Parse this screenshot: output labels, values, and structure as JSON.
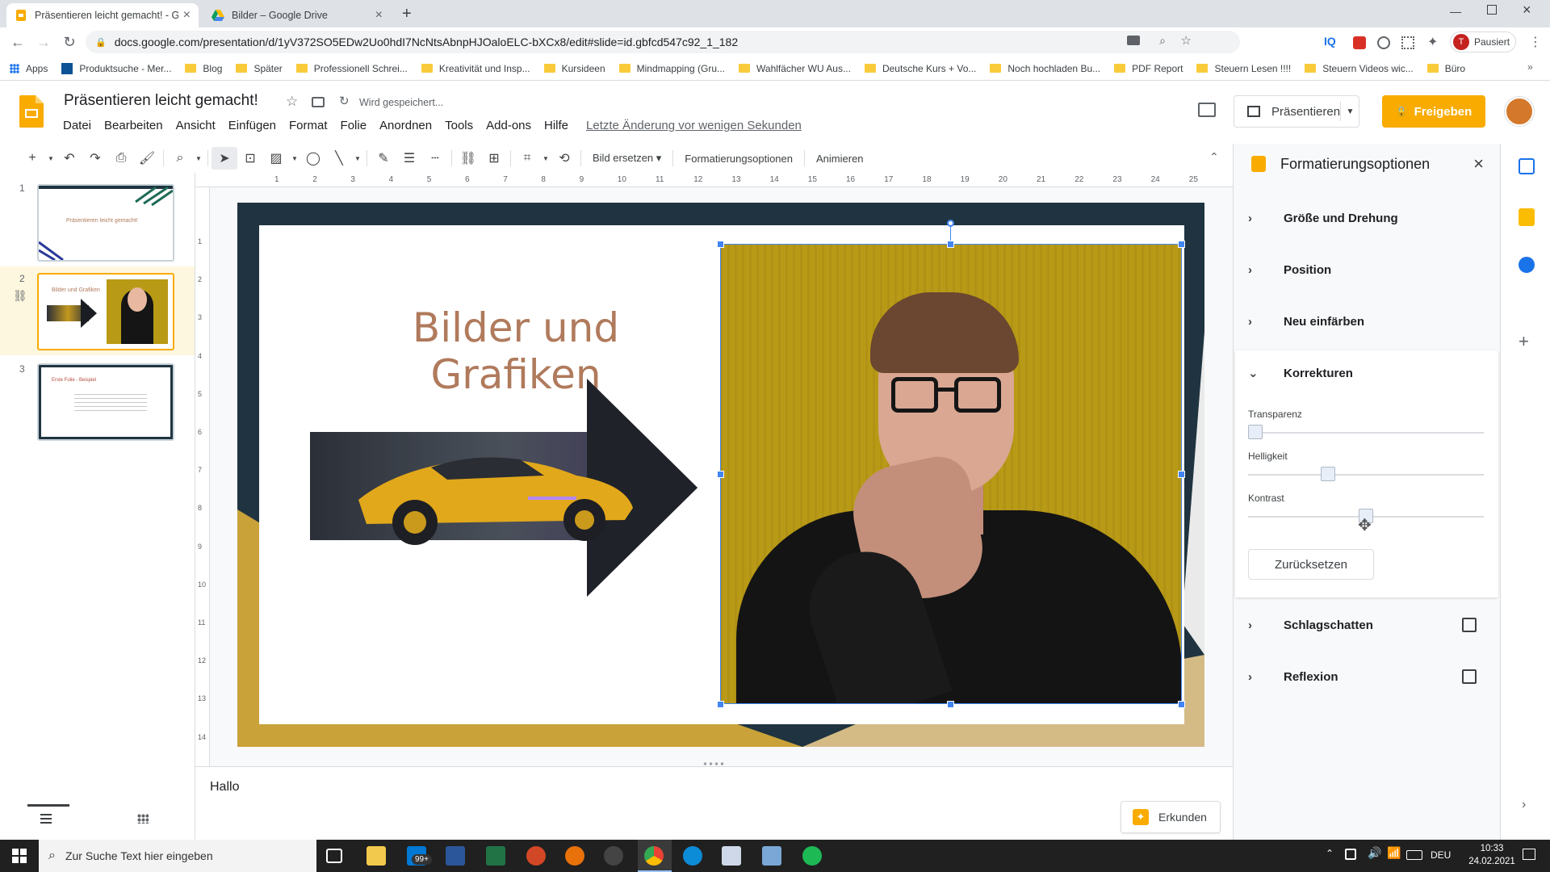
{
  "browser": {
    "tabs": [
      {
        "title": "Präsentieren leicht gemacht! - Go",
        "active": true
      },
      {
        "title": "Bilder – Google Drive",
        "active": false
      }
    ],
    "url": "docs.google.com/presentation/d/1yV372SO5EDw2Uo0hdI7NcNtsAbnpHJOaloELC-bXCx8/edit#slide=id.gbfcd547c92_1_182",
    "profile_label": "Pausiert",
    "profile_initial": "T",
    "bookmarks": [
      "Apps",
      "Produktsuche - Mer...",
      "Blog",
      "Später",
      "Professionell Schrei...",
      "Kreativität und Insp...",
      "Kursideen",
      "Mindmapping (Gru...",
      "Wahlfächer WU Aus...",
      "Deutsche Kurs + Vo...",
      "Noch hochladen Bu...",
      "PDF Report",
      "Steuern Lesen !!!!",
      "Steuern Videos wic...",
      "Büro"
    ]
  },
  "docs": {
    "title": "Präsentieren leicht gemacht!",
    "save_status": "Wird gespeichert...",
    "menu": [
      "Datei",
      "Bearbeiten",
      "Ansicht",
      "Einfügen",
      "Format",
      "Folie",
      "Anordnen",
      "Tools",
      "Add-ons",
      "Hilfe"
    ],
    "last_edit": "Letzte Änderung vor wenigen Sekunden",
    "present_label": "Präsentieren",
    "share_label": "Freigeben"
  },
  "toolbar": {
    "replace_image": "Bild ersetzen",
    "format_options": "Formatierungsoptionen",
    "animate": "Animieren"
  },
  "ruler": {
    "top": [
      "1",
      "2",
      "3",
      "4",
      "5",
      "6",
      "7",
      "8",
      "9",
      "10",
      "11",
      "12",
      "13",
      "14",
      "15",
      "16",
      "17",
      "18",
      "19",
      "20",
      "21",
      "22",
      "23",
      "24",
      "25"
    ],
    "left": [
      "1",
      "2",
      "3",
      "4",
      "5",
      "6",
      "7",
      "8",
      "9",
      "10",
      "11",
      "12",
      "13",
      "14"
    ]
  },
  "slides": [
    {
      "number": "1",
      "title": "Präsentieren leicht gemacht!"
    },
    {
      "number": "2",
      "title": "Bilder und Grafiken"
    },
    {
      "number": "3",
      "title": "Erste Folie - Beispiel"
    }
  ],
  "current_slide": {
    "title": "Bilder und Grafiken"
  },
  "notes": {
    "text": "Hallo"
  },
  "explore_label": "Erkunden",
  "panel": {
    "title": "Formatierungsoptionen",
    "sections": {
      "size": "Größe und Drehung",
      "position": "Position",
      "recolor": "Neu einfärben",
      "adjustments": "Korrekturen",
      "shadow": "Schlagschatten",
      "reflection": "Reflexion"
    },
    "transparency_label": "Transparenz",
    "brightness_label": "Helligkeit",
    "contrast_label": "Kontrast",
    "transparency_value": 0,
    "brightness_value": 0.33,
    "contrast_value": 0.5,
    "reset_label": "Zurücksetzen"
  },
  "taskbar": {
    "search_placeholder": "Zur Suche Text hier eingeben",
    "badge": "99+",
    "lang": "DEU",
    "time": "10:33",
    "date": "24.02.2021"
  },
  "colors": {
    "accent_yellow": "#f9ab00",
    "slide_title": "#b07a5c",
    "slide_dark": "#1f3440",
    "photo_bg": "#b99a16",
    "selection_blue": "#4285f4"
  }
}
